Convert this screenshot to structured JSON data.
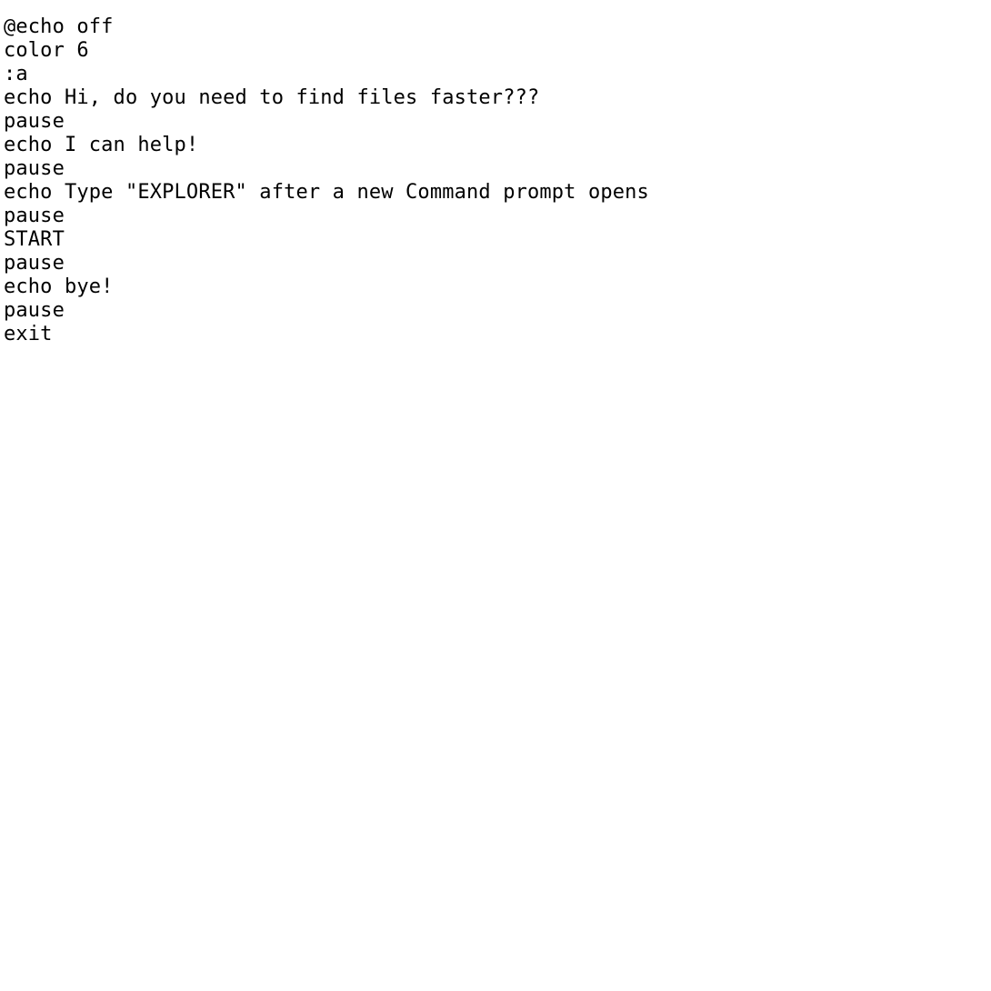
{
  "document": {
    "kind": "batch-script-source",
    "background_color": "#ffffff",
    "text_color": "#000000",
    "line_count": 14,
    "lines": [
      {
        "text": "@echo off"
      },
      {
        "text": "color 6"
      },
      {
        "text": ":a"
      },
      {
        "text": "echo Hi, do you need to find files faster???"
      },
      {
        "text": "pause"
      },
      {
        "text": "echo I can help!"
      },
      {
        "text": "pause"
      },
      {
        "text": "echo Type \"EXPLORER\" after a new Command prompt opens"
      },
      {
        "text": "pause"
      },
      {
        "text": "START"
      },
      {
        "text": "pause"
      },
      {
        "text": "echo bye!"
      },
      {
        "text": "pause"
      },
      {
        "text": "exit"
      }
    ]
  }
}
